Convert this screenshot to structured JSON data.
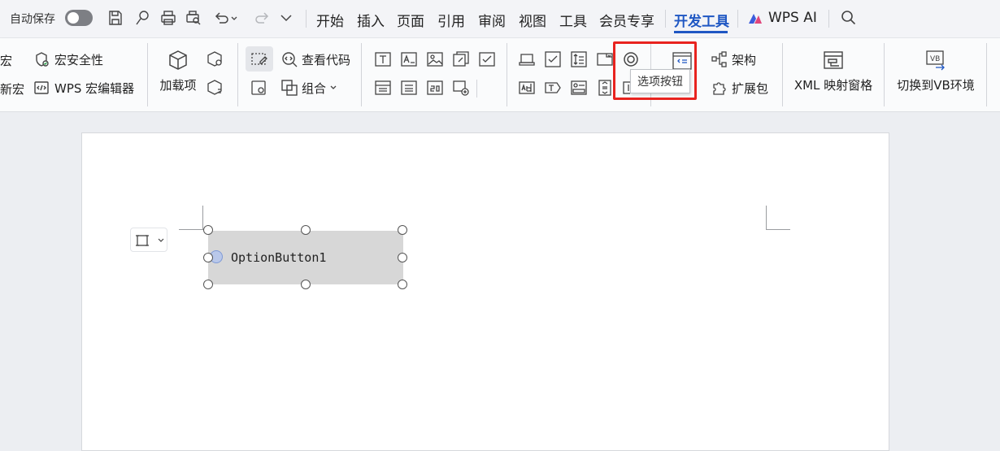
{
  "titlebar": {
    "autosave_label": "自动保存",
    "menu_tabs": [
      "开始",
      "插入",
      "页面",
      "引用",
      "审阅",
      "视图",
      "工具",
      "会员专享",
      "开发工具",
      "WPS AI"
    ],
    "active_tab": "开发工具"
  },
  "ribbon": {
    "macro_label": "宏",
    "macro_security": "宏安全性",
    "new_macro": "新宏",
    "wps_macro_editor": "WPS 宏编辑器",
    "addins": "加载项",
    "view_code": "查看代码",
    "group": "组合",
    "architecture": "架构",
    "extension_pack": "扩展包",
    "xml_mapping_pane": "XML 映射窗格",
    "switch_vb_env": "切换到VB环境"
  },
  "tooltip": {
    "text": "选项按钮"
  },
  "document": {
    "control_label": "OptionButton1"
  },
  "colors": {
    "accent": "#1f57c3",
    "highlight_box": "#e8231f"
  }
}
